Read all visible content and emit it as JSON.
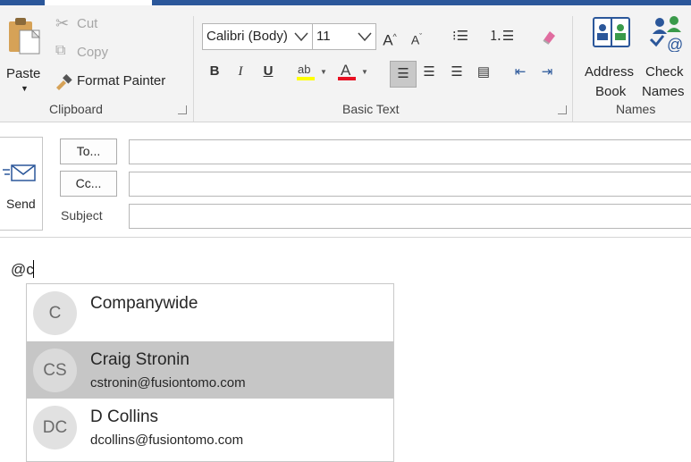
{
  "ribbon": {
    "clipboard": {
      "paste": "Paste",
      "cut": "Cut",
      "copy": "Copy",
      "format_painter": "Format Painter",
      "group_label": "Clipboard"
    },
    "basic_text": {
      "font_name": "Calibri (Body)",
      "font_size": "11",
      "bold": "B",
      "italic": "I",
      "underline": "U",
      "group_label": "Basic Text"
    },
    "names": {
      "address_book": [
        "Address",
        "Book"
      ],
      "check_names": [
        "Check",
        "Names"
      ],
      "group_label": "Names"
    }
  },
  "header": {
    "send": "Send",
    "to_button": "To...",
    "cc_button": "Cc...",
    "subject_label": "Subject",
    "to_value": "",
    "cc_value": "",
    "subject_value": ""
  },
  "body": {
    "typed_text": "@c"
  },
  "mention_suggestions": [
    {
      "initials": "C",
      "name": "Companywide",
      "email": "",
      "selected": false
    },
    {
      "initials": "CS",
      "name": "Craig Stronin",
      "email": "cstronin@fusiontomo.com",
      "selected": true
    },
    {
      "initials": "DC",
      "name": "D Collins",
      "email": "dcollins@fusiontomo.com",
      "selected": false
    }
  ],
  "colors": {
    "accent": "#2b579a",
    "highlight_yellow": "#ffff00",
    "font_red": "#e81123",
    "selected_row": "#c6c6c6"
  }
}
